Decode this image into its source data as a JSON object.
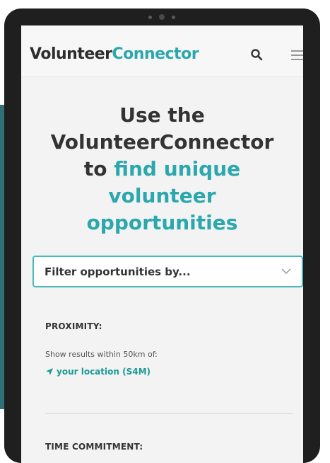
{
  "brand": {
    "part1": "Volunteer",
    "part2": "Connector"
  },
  "hero": {
    "line1": "Use the",
    "line2": "VolunteerConnector",
    "line3_prefix": "to",
    "line3_accent": "find unique",
    "line4": "volunteer",
    "line5": "opportunities"
  },
  "filter": {
    "label": "Filter opportunities by..."
  },
  "proximity": {
    "title": "PROXIMITY:",
    "text": "Show results within 50km of:",
    "location": "your location (S4M)"
  },
  "time_commitment": {
    "title": "TIME COMMITMENT:"
  },
  "icons": {
    "search": "search-icon",
    "menu": "hamburger-menu-icon",
    "chevron": "chevron-down-icon",
    "location": "location-arrow-icon"
  },
  "colors": {
    "accent": "#2ba7ad",
    "text": "#333333",
    "border": "#48b8bd"
  }
}
